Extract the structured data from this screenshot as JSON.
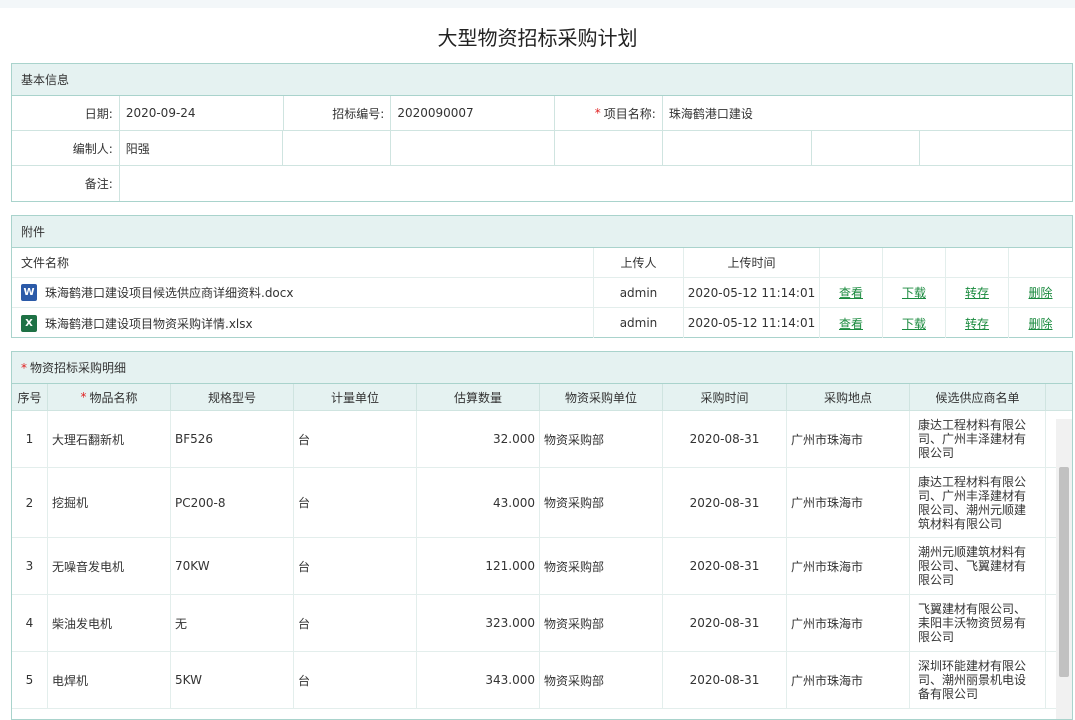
{
  "page_title": "大型物资招标采购计划",
  "basic": {
    "section_title": "基本信息",
    "date_label": "日期:",
    "date_value": "2020-09-24",
    "bid_no_label": "招标编号:",
    "bid_no_value": "2020090007",
    "project_label": "项目名称:",
    "project_value": "珠海鹤港口建设",
    "author_label": "编制人:",
    "author_value": "阳强",
    "remark_label": "备注:",
    "remark_value": ""
  },
  "attachments": {
    "section_title": "附件",
    "headers": {
      "name": "文件名称",
      "uploader": "上传人",
      "time": "上传时间"
    },
    "actions": {
      "view": "查看",
      "download": "下载",
      "transfer": "转存",
      "delete": "删除"
    },
    "files": [
      {
        "icon": "word-file-icon",
        "name": "珠海鹤港口建设项目候选供应商详细资料.docx",
        "uploader": "admin",
        "time": "2020-05-12 11:14:01"
      },
      {
        "icon": "excel-file-icon",
        "name": "珠海鹤港口建设项目物资采购详情.xlsx",
        "uploader": "admin",
        "time": "2020-05-12 11:14:01"
      }
    ]
  },
  "detail": {
    "section_title": "物资招标采购明细",
    "headers": [
      "序号",
      "物品名称",
      "规格型号",
      "计量单位",
      "估算数量",
      "物资采购单位",
      "采购时间",
      "采购地点",
      "候选供应商名单"
    ],
    "rows": [
      {
        "seq": "1",
        "name": "大理石翻新机",
        "spec": "BF526",
        "unit": "台",
        "qty": "32.000",
        "dept": "物资采购部",
        "date": "2020-08-31",
        "place": "广州市珠海市",
        "suppliers": "康达工程材料有限公司、广州丰泽建材有限公司"
      },
      {
        "seq": "2",
        "name": "挖掘机",
        "spec": "PC200-8",
        "unit": "台",
        "qty": "43.000",
        "dept": "物资采购部",
        "date": "2020-08-31",
        "place": "广州市珠海市",
        "suppliers": "康达工程材料有限公司、广州丰泽建材有限公司、潮州元顺建筑材料有限公司"
      },
      {
        "seq": "3",
        "name": "无噪音发电机",
        "spec": "70KW",
        "unit": "台",
        "qty": "121.000",
        "dept": "物资采购部",
        "date": "2020-08-31",
        "place": "广州市珠海市",
        "suppliers": "潮州元顺建筑材料有限公司、飞翼建材有限公司"
      },
      {
        "seq": "4",
        "name": "柴油发电机",
        "spec": "无",
        "unit": "台",
        "qty": "323.000",
        "dept": "物资采购部",
        "date": "2020-08-31",
        "place": "广州市珠海市",
        "suppliers": "飞翼建材有限公司、耒阳丰沃物资贸易有限公司"
      },
      {
        "seq": "5",
        "name": "电焊机",
        "spec": "5KW",
        "unit": "台",
        "qty": "343.000",
        "dept": "物资采购部",
        "date": "2020-08-31",
        "place": "广州市珠海市",
        "suppliers": "深圳环能建材有限公司、潮州丽景机电设备有限公司"
      }
    ]
  }
}
